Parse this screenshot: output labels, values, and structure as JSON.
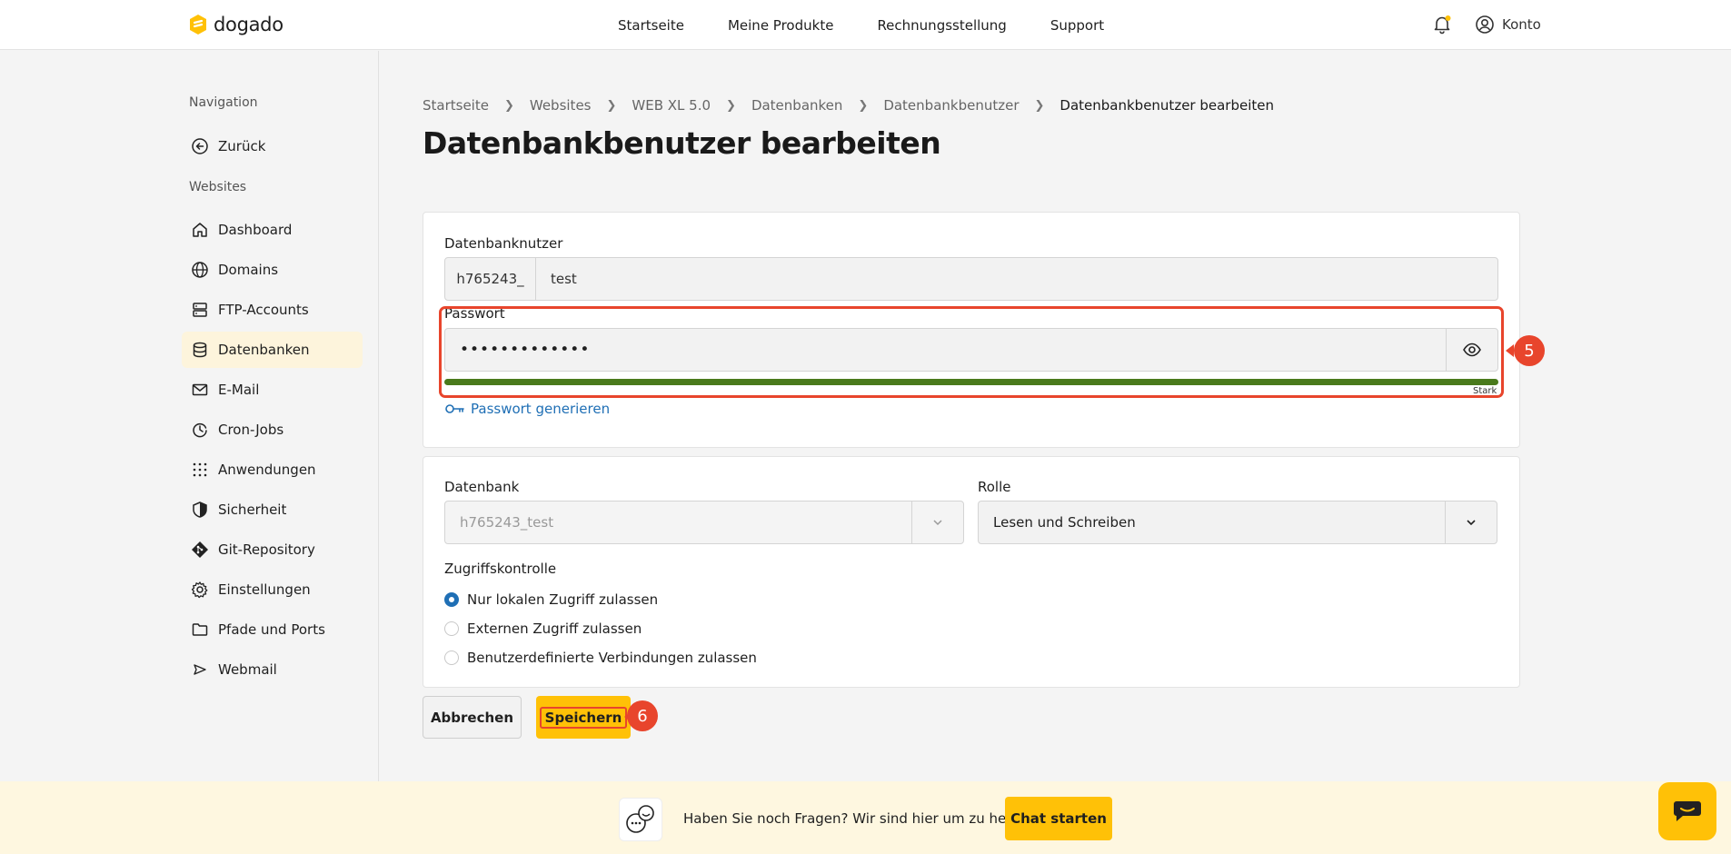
{
  "brand": {
    "name": "dogado",
    "accent": "#ffc107"
  },
  "topnav": {
    "items": [
      "Startseite",
      "Meine Produkte",
      "Rechnungsstellung",
      "Support"
    ],
    "account_label": "Konto"
  },
  "sidebar": {
    "nav_heading": "Navigation",
    "back_label": "Zurück",
    "section_heading": "Websites",
    "items": [
      {
        "label": "Dashboard",
        "icon": "home-icon"
      },
      {
        "label": "Domains",
        "icon": "globe-icon"
      },
      {
        "label": "FTP-Accounts",
        "icon": "server-icon"
      },
      {
        "label": "Datenbanken",
        "icon": "database-icon",
        "active": true
      },
      {
        "label": "E-Mail",
        "icon": "mail-icon"
      },
      {
        "label": "Cron-Jobs",
        "icon": "cron-icon"
      },
      {
        "label": "Anwendungen",
        "icon": "grid-icon"
      },
      {
        "label": "Sicherheit",
        "icon": "shield-icon"
      },
      {
        "label": "Git-Repository",
        "icon": "git-icon"
      },
      {
        "label": "Einstellungen",
        "icon": "gear-icon"
      },
      {
        "label": "Pfade und Ports",
        "icon": "folder-icon"
      },
      {
        "label": "Webmail",
        "icon": "send-icon"
      }
    ]
  },
  "breadcrumb": {
    "items": [
      "Startseite",
      "Websites",
      "WEB XL 5.0",
      "Datenbanken",
      "Datenbankbenutzer"
    ],
    "current": "Datenbankbenutzer bearbeiten"
  },
  "page": {
    "title": "Datenbankbenutzer bearbeiten"
  },
  "form": {
    "user_label": "Datenbanknutzer",
    "user_prefix": "h765243_",
    "user_value": "test",
    "password_label": "Passwort",
    "password_value": "•••••••••••••",
    "strength_label": "Stark",
    "generate_label": "Passwort generieren",
    "database_label": "Datenbank",
    "database_value": "h765243_test",
    "role_label": "Rolle",
    "role_value": "Lesen und Schreiben",
    "access_label": "Zugriffskontrolle",
    "access_options": [
      {
        "label": "Nur lokalen Zugriff zulassen",
        "checked": true
      },
      {
        "label": "Externen Zugriff zulassen",
        "checked": false
      },
      {
        "label": "Benutzerdefinierte Verbindungen zulassen",
        "checked": false
      }
    ],
    "cancel_label": "Abbrechen",
    "save_label": "Speichern"
  },
  "annotations": {
    "marker_password": "5",
    "marker_save": "6",
    "color": "#e8452c"
  },
  "footer": {
    "help_text": "Haben Sie noch Fragen? Wir sind hier um zu helfen.",
    "chat_label": "Chat starten"
  }
}
